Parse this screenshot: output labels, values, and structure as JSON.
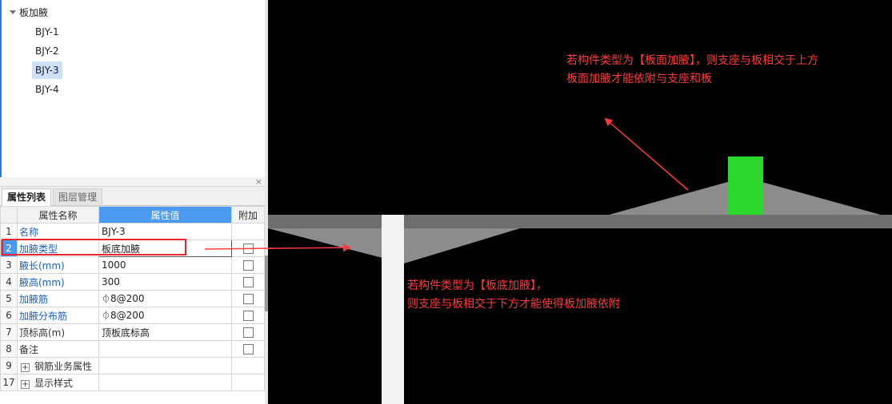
{
  "tree": {
    "root_label": "板加腋",
    "items": [
      "BJY-1",
      "BJY-2",
      "BJY-3",
      "BJY-4"
    ],
    "selected": "BJY-3"
  },
  "panel": {
    "close_glyph": "×",
    "tabs": [
      "属性列表",
      "图层管理"
    ],
    "columns": [
      "属性名称",
      "属性值",
      "附加"
    ]
  },
  "rows": [
    {
      "num": "1",
      "name": "名称",
      "value": "BJY-3",
      "blue": true,
      "checkbox": false
    },
    {
      "num": "2",
      "name": "加腋类型",
      "value": "板底加腋",
      "blue": true,
      "checkbox": true
    },
    {
      "num": "3",
      "name": "腋长(mm)",
      "value": "1000",
      "blue": true,
      "checkbox": true
    },
    {
      "num": "4",
      "name": "腋高(mm)",
      "value": "300",
      "blue": true,
      "checkbox": true
    },
    {
      "num": "5",
      "name": "加腋筋",
      "value": "8@200",
      "rebar": "⏀",
      "blue": true,
      "checkbox": true
    },
    {
      "num": "6",
      "name": "加腋分布筋",
      "value": "8@200",
      "rebar": "⏀",
      "blue": true,
      "checkbox": true
    },
    {
      "num": "7",
      "name": "顶标高(m)",
      "value": "顶板底标高",
      "blue": false,
      "checkbox": true
    },
    {
      "num": "8",
      "name": "备注",
      "value": "",
      "blue": false,
      "checkbox": true
    },
    {
      "num": "9",
      "name": "钢筋业务属性",
      "value": "",
      "blue": false,
      "checkbox": false,
      "expand": "+"
    },
    {
      "num": "17",
      "name": "显示样式",
      "value": "",
      "blue": false,
      "checkbox": false,
      "expand": "+"
    }
  ],
  "annotations": {
    "top_line1": "若构件类型为【板面加腋】，则支座与板相交于上方",
    "top_line2": "板面加腋才能依附与支座和板",
    "bottom_line1": "若构件类型为【板底加腋】，",
    "bottom_line2": "则支座与板相交于下方才能使得板加腋依附"
  },
  "colors": {
    "slab": "#6e6e6e",
    "haunch": "#8c8c8c",
    "support": "#2ad72a",
    "column": "#f2f2f2",
    "annotation": "#ff3a3a",
    "highlight": "#e8262d"
  }
}
